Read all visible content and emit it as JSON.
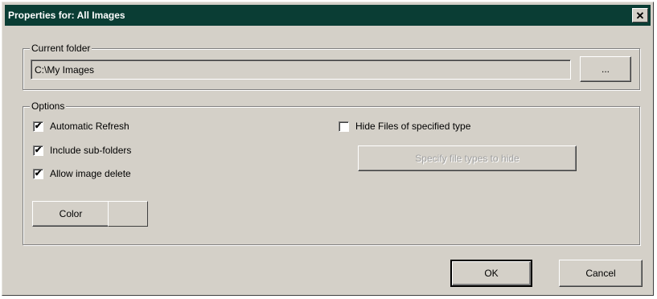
{
  "window": {
    "title": "Properties for: All Images",
    "close_glyph": "✕"
  },
  "current_folder": {
    "label": "Current folder",
    "path": "C:\\My Images",
    "browse_label": "..."
  },
  "options": {
    "label": "Options",
    "checkboxes": [
      {
        "label": "Automatic Refresh",
        "checked": true,
        "glyph": "✔"
      },
      {
        "label": "Include sub-folders",
        "checked": true,
        "glyph": "✔"
      },
      {
        "label": "Allow image delete",
        "checked": true,
        "glyph": "✔"
      }
    ],
    "hide_files": {
      "label": "Hide Files of specified type",
      "checked": false,
      "glyph": ""
    },
    "specify_button": "Specify file types to hide",
    "color_button": "Color"
  },
  "buttons": {
    "ok": "OK",
    "cancel": "Cancel"
  }
}
